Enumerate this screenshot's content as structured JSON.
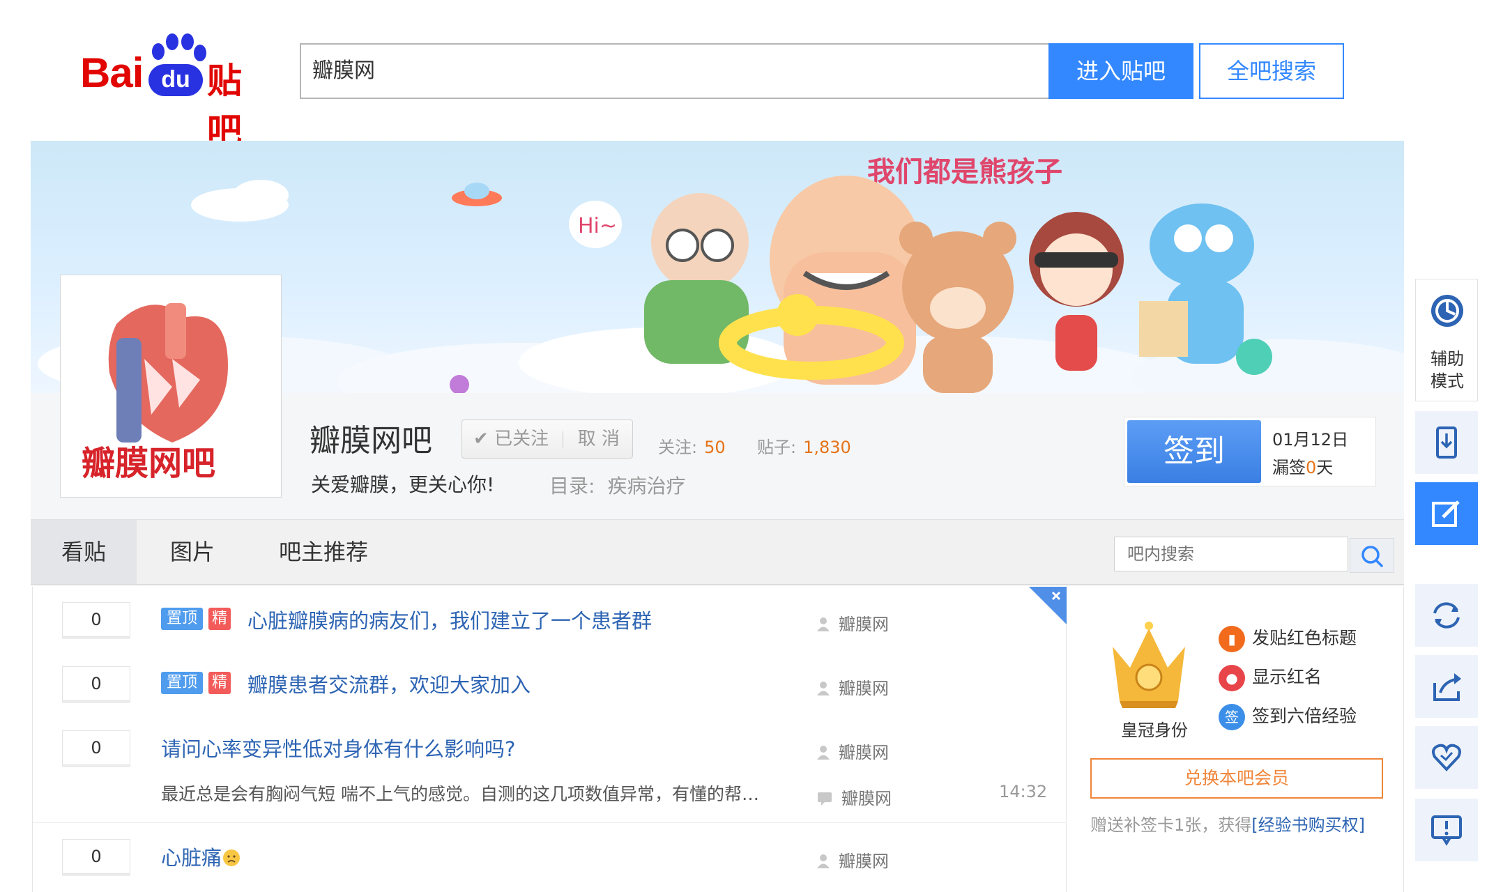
{
  "header": {
    "logo": {
      "brand": "Bai",
      "du": "du",
      "product": "贴吧"
    },
    "search_value": "瓣膜网",
    "enter_button": "进入贴吧",
    "global_search_button": "全吧搜索"
  },
  "banner": {
    "slogan_art": "我们都是熊孩子",
    "hi_bubble": "Hi~"
  },
  "forum": {
    "name": "瓣膜网吧",
    "avatar_text": "瓣膜网吧",
    "follow_state": "已关注",
    "unfollow": "取 消",
    "follow_label": "关注:",
    "follow_count": "50",
    "posts_label": "贴子:",
    "posts_count": "1,830",
    "slogan": "关爱瓣膜，更关心你!",
    "catalog_label": "目录:",
    "catalog_value": "疾病治疗"
  },
  "signin": {
    "button": "签到",
    "date": "01月12日",
    "missed_prefix": "漏签",
    "missed_days": "0",
    "missed_suffix": "天"
  },
  "tabs": [
    {
      "label": "看贴",
      "active": true
    },
    {
      "label": "图片",
      "active": false
    },
    {
      "label": "吧主推荐",
      "active": false
    }
  ],
  "bar_search_placeholder": "吧内搜索",
  "threads": [
    {
      "replies": "0",
      "top_tag": "置顶",
      "good_tag": "精",
      "title": "心脏瓣膜病的病友们，我们建立了一个患者群",
      "author": "瓣膜网"
    },
    {
      "replies": "0",
      "top_tag": "置顶",
      "good_tag": "精",
      "title": "瓣膜患者交流群，欢迎大家加入",
      "author": "瓣膜网"
    },
    {
      "replies": "0",
      "title": "请问心率变异性低对身体有什么影响吗?",
      "author": "瓣膜网",
      "abstract": "最近总是会有胸闷气短 喘不上气的感觉。自测的这几项数值异常，有懂的帮…",
      "last_reply_author": "瓣膜网",
      "time": "14:32"
    },
    {
      "replies": "0",
      "title": "心脏痛",
      "author": "瓣膜网"
    }
  ],
  "member": {
    "crown_label": "皇冠身份",
    "perks": [
      {
        "label": "发贴红色标题",
        "color": "#f26b1d"
      },
      {
        "label": "显示红名",
        "color": "#e8454a"
      },
      {
        "label": "签到六倍经验",
        "color": "#3c8fe8",
        "icon_text": "签"
      }
    ],
    "redeem_button": "兑换本吧会员",
    "gift_text": "赠送补签卡1张，获得",
    "gift_link": "[经验书购买权]"
  },
  "side_tools": {
    "assist_label_1": "辅助",
    "assist_label_2": "模式"
  },
  "colors": {
    "brand_red": "#e10601",
    "brand_blue": "#2932e1",
    "primary": "#3388ff",
    "link": "#2d64b3",
    "accent_orange": "#e67317"
  }
}
